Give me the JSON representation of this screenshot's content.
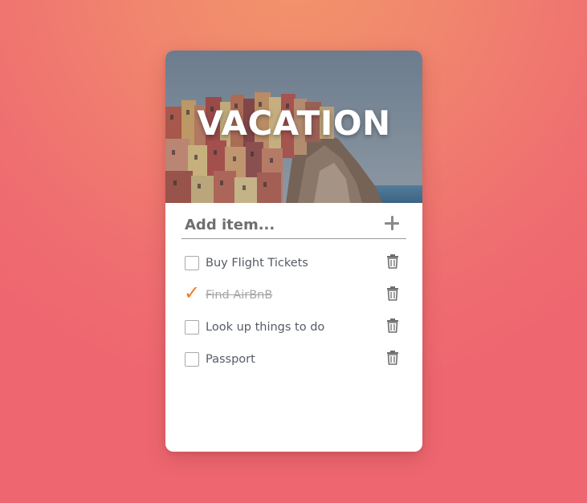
{
  "card": {
    "title": "VACATION"
  },
  "add_item": {
    "placeholder": "Add item...",
    "value": ""
  },
  "items": [
    {
      "label": "Buy Flight Tickets",
      "done": false
    },
    {
      "label": "Find AirBnB",
      "done": true
    },
    {
      "label": "Look up things to do",
      "done": false
    },
    {
      "label": "Passport",
      "done": false
    }
  ],
  "icons": {
    "add": "plus-icon",
    "delete": "trash-icon",
    "done": "checkmark-icon"
  },
  "colors": {
    "accent_check": "#f47a1f",
    "background_top": "#f2946a",
    "background_bottom": "#ee6770"
  }
}
